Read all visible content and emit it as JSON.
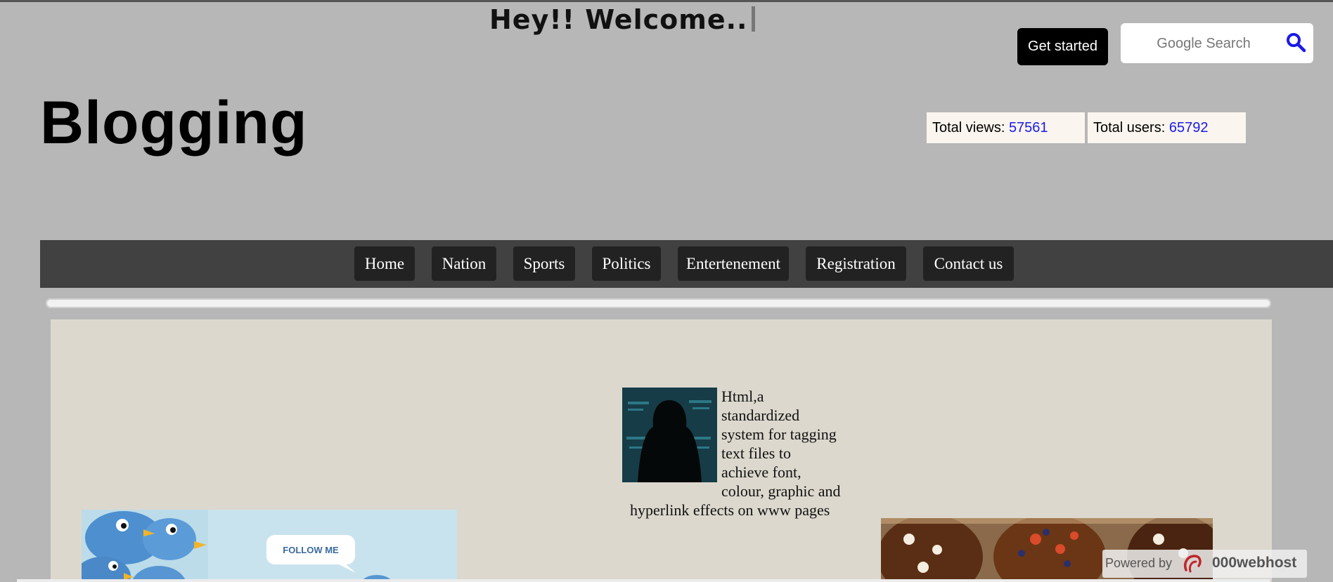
{
  "header": {
    "welcome_text": "Hey!! Welcome..",
    "get_started_label": "Get started",
    "search_placeholder": "Google Search"
  },
  "brand": {
    "title": "Blogging"
  },
  "stats": {
    "views_label": "Total views: ",
    "views_value": "57561",
    "users_label": "Total users: ",
    "users_value": "65792"
  },
  "nav": {
    "items": [
      {
        "label": "Home"
      },
      {
        "label": "Nation"
      },
      {
        "label": "Sports"
      },
      {
        "label": "Politics"
      },
      {
        "label": "Entertenement"
      },
      {
        "label": "Registration"
      },
      {
        "label": "Contact us"
      }
    ]
  },
  "content": {
    "article_text": "Html,a standardized system for tagging text files to achieve font, colour, graphic and hyperlink effects on www pages",
    "twitter_image_text": "FOLLOW ME"
  },
  "footer": {
    "powered_by": "Powered by",
    "host_name": "000webhost"
  },
  "colors": {
    "page_background": "#b7b7b7",
    "navbar": "#414141",
    "nav_button": "#222222",
    "content_background": "#dcd8ce",
    "stat_number": "#1a1ae6",
    "search_icon": "#1a1ae6"
  },
  "icons": [
    "search-icon",
    "000webhost-logo-icon"
  ]
}
